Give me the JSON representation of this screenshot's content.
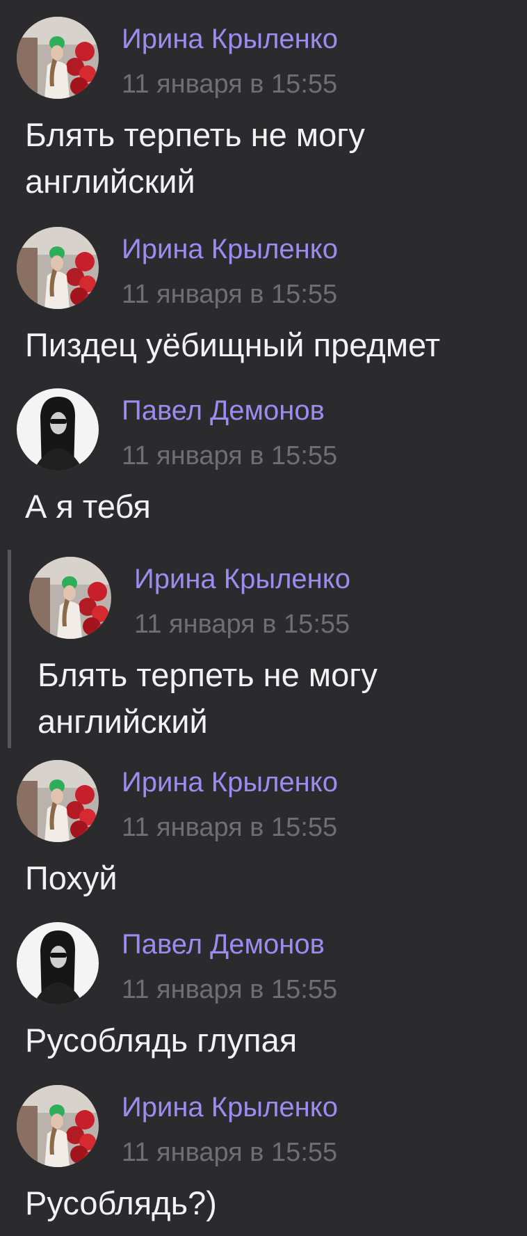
{
  "messages": [
    {
      "author": "Ирина Крыленко",
      "time": "11 января в 15:55",
      "avatar": "irina-avatar",
      "text": "Блять терпеть не могу английский"
    },
    {
      "author": "Ирина Крыленко",
      "time": "11 января в 15:55",
      "avatar": "irina-avatar",
      "text": "Пиздец уёбищный предмет"
    },
    {
      "author": "Павел Демонов",
      "time": "11 января в 15:55",
      "avatar": "pavel-avatar",
      "text": "А я тебя"
    },
    {
      "author": "Ирина Крыленко",
      "time": "11 января в 15:55",
      "avatar": "irina-avatar",
      "text": "Блять терпеть не могу английский",
      "quoted": true
    },
    {
      "author": "Ирина Крыленко",
      "time": "11 января в 15:55",
      "avatar": "irina-avatar",
      "text": "Похуй"
    },
    {
      "author": "Павел Демонов",
      "time": "11 января в 15:55",
      "avatar": "pavel-avatar",
      "text": "Русоблядь глупая"
    },
    {
      "author": "Ирина Крыленко",
      "time": "11 января в 15:55",
      "avatar": "irina-avatar",
      "text": "Русоблядь?)"
    }
  ],
  "colors": {
    "background": "#2b2b2e",
    "author": "#9d8cf0",
    "time": "#6f6f73",
    "text": "#f2f2f2",
    "quote_bar": "#56565b"
  }
}
